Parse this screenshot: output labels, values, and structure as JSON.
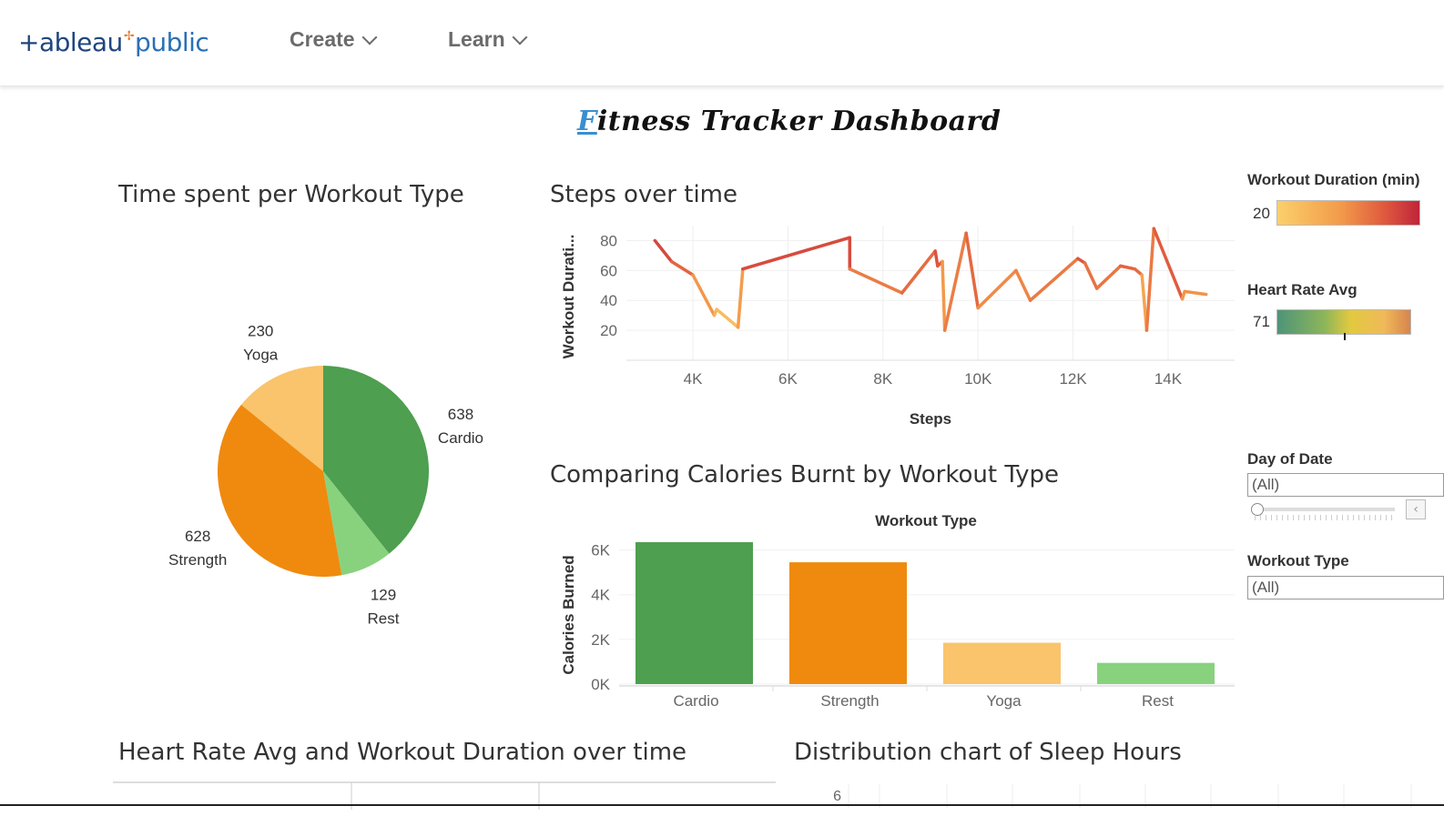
{
  "header": {
    "logo": {
      "part1": "+ableau",
      "part2": "public",
      "icon": "tableau-plus-icon"
    },
    "nav": [
      {
        "label": "Create",
        "icon": "chevron-down-icon"
      },
      {
        "label": "Learn",
        "icon": "chevron-down-icon"
      }
    ]
  },
  "dashboard": {
    "title_first": "F",
    "title_rest": "itness Tracker Dashboard"
  },
  "worksheets": {
    "pie_title": "Time spent per Workout Type",
    "line_title": "Steps over time",
    "bar_title": "Comparing Calories Burnt by Workout Type",
    "heart_title": "Heart Rate Avg and Workout Duration over time",
    "sleep_title": "Distribution chart of Sleep Hours",
    "sleep_first_tick": "6"
  },
  "filters": {
    "duration_legend_title": "Workout Duration (min)",
    "duration_min": "20",
    "heart_legend_title": "Heart Rate Avg",
    "heart_min": "71",
    "day_title": "Day of Date",
    "day_value": "(All)",
    "type_title": "Workout Type",
    "type_value": "(All)"
  },
  "colors": {
    "cardio": "#4e9f4f",
    "strength": "#ef8a0f",
    "yoga": "#f9c46b",
    "rest": "#88d27e"
  },
  "chart_data": [
    {
      "type": "pie",
      "title": "Time spent per Workout Type",
      "slices": [
        {
          "label": "Cardio",
          "value": 638
        },
        {
          "label": "Rest",
          "value": 129
        },
        {
          "label": "Strength",
          "value": 628
        },
        {
          "label": "Yoga",
          "value": 230
        }
      ]
    },
    {
      "type": "line",
      "title": "Steps over time",
      "xlabel": "Steps",
      "ylabel": "Workout Durati...",
      "xlim": [
        2600,
        15400
      ],
      "ylim": [
        0,
        90
      ],
      "xticks": [
        4000,
        6000,
        8000,
        10000,
        12000,
        14000
      ],
      "xtick_labels": [
        "4K",
        "6K",
        "8K",
        "10K",
        "12K",
        "14K"
      ],
      "yticks": [
        20,
        40,
        60,
        80
      ],
      "points": [
        [
          3200,
          80
        ],
        [
          3550,
          66
        ],
        [
          4000,
          57
        ],
        [
          4450,
          30
        ],
        [
          4500,
          34
        ],
        [
          4950,
          22
        ],
        [
          5050,
          61
        ],
        [
          7300,
          82
        ],
        [
          7300,
          61
        ],
        [
          8400,
          45
        ],
        [
          9100,
          73
        ],
        [
          9150,
          63
        ],
        [
          9250,
          66
        ],
        [
          9300,
          20
        ],
        [
          9750,
          85
        ],
        [
          10000,
          35
        ],
        [
          10800,
          60
        ],
        [
          11100,
          40
        ],
        [
          12100,
          68
        ],
        [
          12250,
          65
        ],
        [
          12500,
          48
        ],
        [
          13000,
          63
        ],
        [
          13300,
          61
        ],
        [
          13450,
          57
        ],
        [
          13550,
          20
        ],
        [
          13700,
          88
        ],
        [
          14300,
          41
        ],
        [
          14350,
          46
        ],
        [
          14800,
          44
        ]
      ]
    },
    {
      "type": "bar",
      "title": "Comparing Calories Burnt by Workout Type",
      "xlabel": "Workout Type",
      "ylabel": "Calories Burned",
      "categories": [
        "Cardio",
        "Strength",
        "Yoga",
        "Rest"
      ],
      "values": [
        6350,
        5450,
        1850,
        950
      ],
      "yticks": [
        0,
        2000,
        4000,
        6000
      ],
      "ytick_labels": [
        "0K",
        "2K",
        "4K",
        "6K"
      ],
      "ylim": [
        0,
        7000
      ]
    }
  ]
}
